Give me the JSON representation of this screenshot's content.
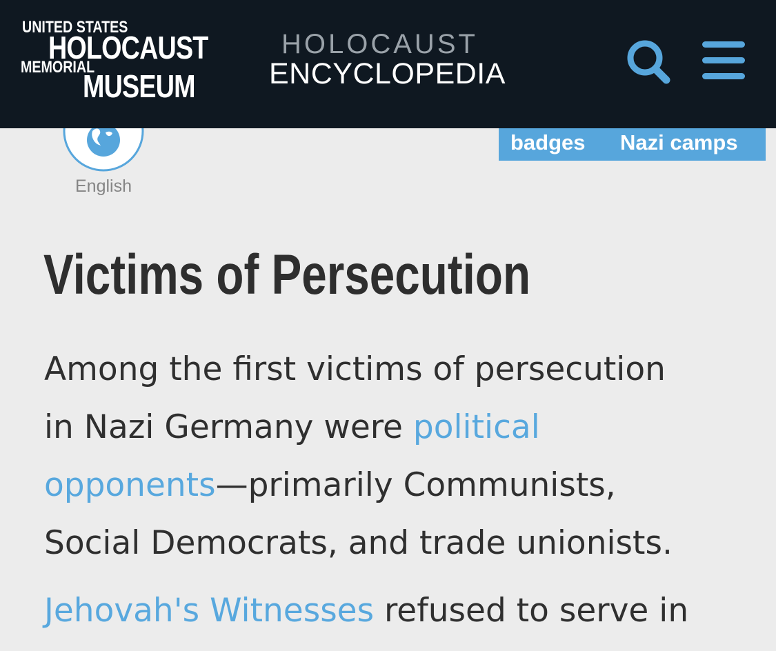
{
  "header": {
    "logo": {
      "line1": "UNITED STATES",
      "line2": "HOLOCAUST",
      "line3": "MEMORIAL",
      "line4": "MUSEUM"
    },
    "encyclopedia_title_top": "HOLOCAUST",
    "encyclopedia_title_bottom": "ENCYCLOPEDIA",
    "search_icon": "search-icon",
    "menu_icon": "hamburger-menu-icon"
  },
  "language": {
    "icon": "globe-icon",
    "label": "English"
  },
  "tags": [
    "badges",
    "Nazi camps"
  ],
  "article": {
    "title": "Victims of Persecution",
    "lines": {
      "l1": "Among the first victims of persecution",
      "l2_text": "in Nazi Germany were ",
      "l2_link": "political",
      "l3_link": "opponents",
      "l3_text": "—primarily Communists,",
      "l4": "Social Democrats, and trade unionists.",
      "l5_link": "Jehovah's Witnesses",
      "l5_text": " refused to serve in"
    }
  },
  "colors": {
    "header_bg": "#0f1821",
    "accent_blue": "#57a6dc",
    "page_bg": "#ececec",
    "text": "#2f2f2f"
  }
}
